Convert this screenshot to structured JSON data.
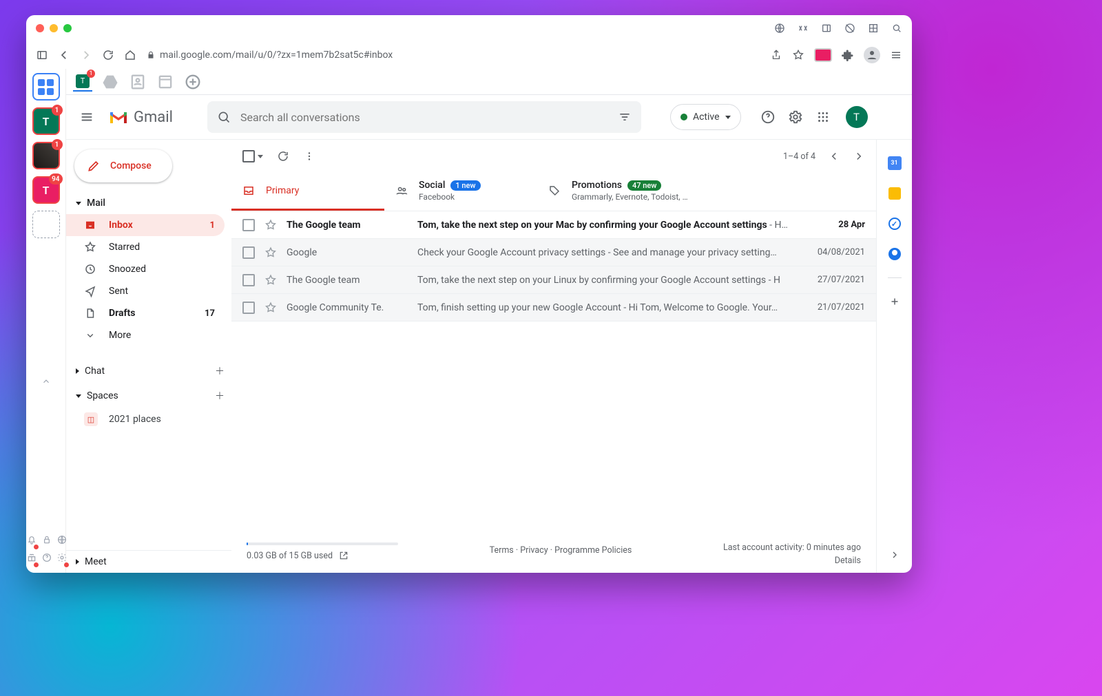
{
  "browser": {
    "url": "mail.google.com/mail/u/0/?zx=1mem7b2sat5c#inbox"
  },
  "leftdock": {
    "items": [
      {
        "badge": null
      },
      {
        "letter": "T",
        "badge": "1"
      },
      {
        "letter": "",
        "badge": "1"
      },
      {
        "letter": "T",
        "badge": "94"
      }
    ]
  },
  "tabstrip": {
    "active_letter": "T",
    "active_badge": "1"
  },
  "gmail": {
    "product": "Gmail",
    "search_placeholder": "Search all conversations",
    "status": "Active",
    "avatar": "T",
    "compose": "Compose",
    "sections": {
      "mail": "Mail",
      "chat": "Chat",
      "spaces": "Spaces",
      "meet": "Meet"
    },
    "nav": [
      {
        "label": "Inbox",
        "count": "1"
      },
      {
        "label": "Starred"
      },
      {
        "label": "Snoozed"
      },
      {
        "label": "Sent"
      },
      {
        "label": "Drafts",
        "count": "17"
      },
      {
        "label": "More"
      }
    ],
    "spaces_items": [
      {
        "label": "2021 places"
      }
    ],
    "pagination": "1–4 of 4",
    "categories": [
      {
        "label": "Primary"
      },
      {
        "label": "Social",
        "badge": "1 new",
        "sub": "Facebook"
      },
      {
        "label": "Promotions",
        "badge": "47 new",
        "sub": "Grammarly, Evernote, Todoist, …"
      }
    ],
    "emails": [
      {
        "unread": true,
        "sender": "The Google team",
        "subject": "Tom, take the next step on your Mac by confirming your Google Account settings",
        "snippet": " - H…",
        "date": "28 Apr"
      },
      {
        "unread": false,
        "sender": "Google",
        "subject": "Check your Google Account privacy settings",
        "snippet": " - See and manage your privacy setting…",
        "date": "04/08/2021"
      },
      {
        "unread": false,
        "sender": "The Google team",
        "subject": "Tom, take the next step on your Linux by confirming your Google Account settings",
        "snippet": " - H",
        "date": "27/07/2021"
      },
      {
        "unread": false,
        "sender": "Google Community Te.",
        "subject": "Tom, finish setting up your new Google Account",
        "snippet": " - Hi Tom, Welcome to Google. Your…",
        "date": "21/07/2021"
      }
    ],
    "footer": {
      "storage": "0.03 GB of 15 GB used",
      "links": "Terms · Privacy · Programme Policies",
      "activity": "Last account activity: 0 minutes ago",
      "details": "Details"
    },
    "sidepanel_cal": "31"
  }
}
